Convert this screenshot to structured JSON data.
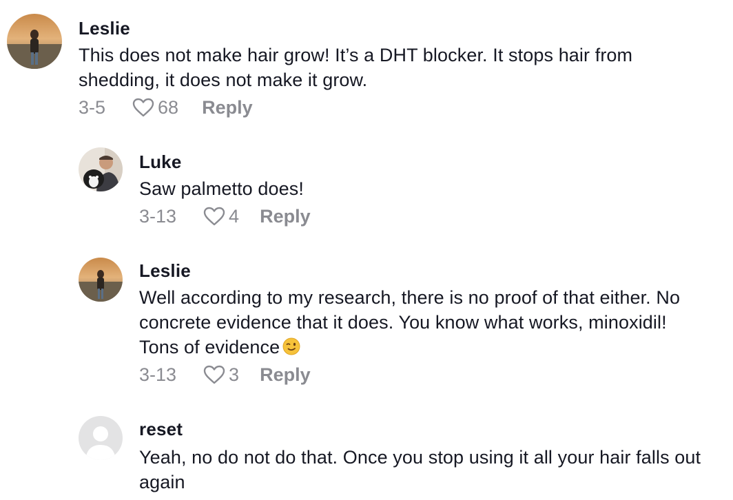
{
  "comments": [
    {
      "username": "Leslie",
      "text": "This does not make hair grow! It’s a DHT blocker. It stops hair from shedding, it does not make it grow.",
      "date": "3-5",
      "likes": "68",
      "reply_label": "Reply"
    },
    {
      "username": "Luke",
      "text": "Saw palmetto does!",
      "date": "3-13",
      "likes": "4",
      "reply_label": "Reply"
    },
    {
      "username": "Leslie",
      "text": "Well according to my research, there is no proof of that either. No concrete evidence that it does. You know what works, minoxidil! Tons of evidence",
      "emoji": "winking-face",
      "date": "3-13",
      "likes": "3",
      "reply_label": "Reply"
    },
    {
      "username": "reset",
      "text": "Yeah, no do not do that. Once you stop using it all your hair falls out again"
    }
  ],
  "colors": {
    "text_primary": "#161823",
    "text_secondary": "#8a8b91",
    "background": "#ffffff"
  }
}
